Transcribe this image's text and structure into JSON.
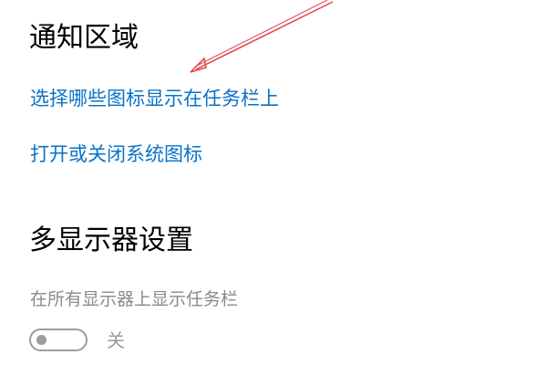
{
  "notification_area": {
    "title": "通知区域",
    "link_choose_icons": "选择哪些图标显示在任务栏上",
    "link_system_icons": "打开或关闭系统图标"
  },
  "multiple_displays": {
    "title": "多显示器设置",
    "show_taskbar_label": "在所有显示器上显示任务栏",
    "toggle_state": "关",
    "toggle_on": false
  },
  "colors": {
    "link": "#0a72c7",
    "disabled": "#8a8a8a",
    "annotation_arrow": "#e0424a"
  }
}
